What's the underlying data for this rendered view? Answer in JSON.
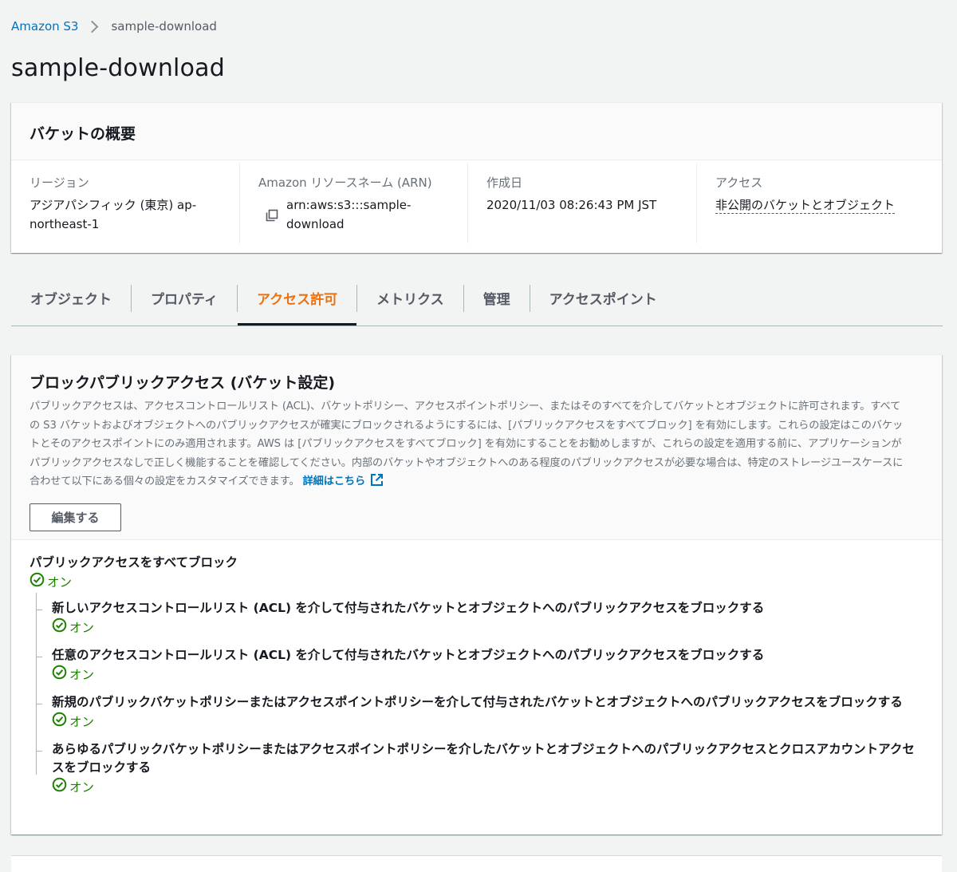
{
  "breadcrumb": {
    "root": "Amazon S3",
    "current": "sample-download"
  },
  "page": {
    "title": "sample-download"
  },
  "overview": {
    "title": "バケットの概要",
    "region_label": "リージョン",
    "region_value": "アジアパシフィック (東京) ap-northeast-1",
    "arn_label": "Amazon リソースネーム (ARN)",
    "arn_value": "arn:aws:s3:::sample-download",
    "created_label": "作成日",
    "created_value": "2020/11/03 08:26:43 PM JST",
    "access_label": "アクセス",
    "access_value": "非公開のバケットとオブジェクト"
  },
  "tabs": [
    {
      "label": "オブジェクト"
    },
    {
      "label": "プロパティ"
    },
    {
      "label": "アクセス許可"
    },
    {
      "label": "メトリクス"
    },
    {
      "label": "管理"
    },
    {
      "label": "アクセスポイント"
    }
  ],
  "active_tab": "アクセス許可",
  "block_public_access": {
    "title": "ブロックパブリックアクセス (バケット設定)",
    "description": "パブリックアクセスは、アクセスコントロールリスト (ACL)、バケットポリシー、アクセスポイントポリシー、またはそのすべてを介してバケットとオブジェクトに許可されます。すべての S3 バケットおよびオブジェクトへのパブリックアクセスが確実にブロックされるようにするには、[パブリックアクセスをすべてブロック] を有効にします。これらの設定はこのバケットとそのアクセスポイントにのみ適用されます。AWS は [パブリックアクセスをすべてブロック] を有効にすることをお勧めしますが、これらの設定を適用する前に、アプリケーションがパブリックアクセスなしで正しく機能することを確認してください。内部のバケットやオブジェクトへのある程度のパブリックアクセスが必要な場合は、特定のストレージユースケースに合わせて以下にある個々の設定をカスタマイズできます。",
    "learn_more": "詳細はこちら",
    "edit_button": "編集する",
    "main_setting": {
      "label": "パブリックアクセスをすべてブロック",
      "status": "オン"
    },
    "sub_settings": [
      {
        "label": "新しいアクセスコントロールリスト (ACL) を介して付与されたバケットとオブジェクトへのパブリックアクセスをブロックする",
        "status": "オン"
      },
      {
        "label": "任意のアクセスコントロールリスト (ACL) を介して付与されたバケットとオブジェクトへのパブリックアクセスをブロックする",
        "status": "オン"
      },
      {
        "label": "新規のパブリックバケットポリシーまたはアクセスポイントポリシーを介して付与されたバケットとオブジェクトへのパブリックアクセスをブロックする",
        "status": "オン"
      },
      {
        "label": "あらゆるパブリックバケットポリシーまたはアクセスポイントポリシーを介したバケットとオブジェクトへのパブリックアクセスとクロスアカウントアクセスをブロックする",
        "status": "オン"
      }
    ]
  },
  "colors": {
    "link": "#0073bb",
    "active_tab": "#ec7211",
    "success": "#1d8102",
    "background": "#f2f3f3"
  },
  "icons": {
    "breadcrumb_separator": "chevron-right-icon",
    "copy": "copy-icon",
    "external_link": "external-link-icon",
    "status": "check-circle-icon"
  }
}
